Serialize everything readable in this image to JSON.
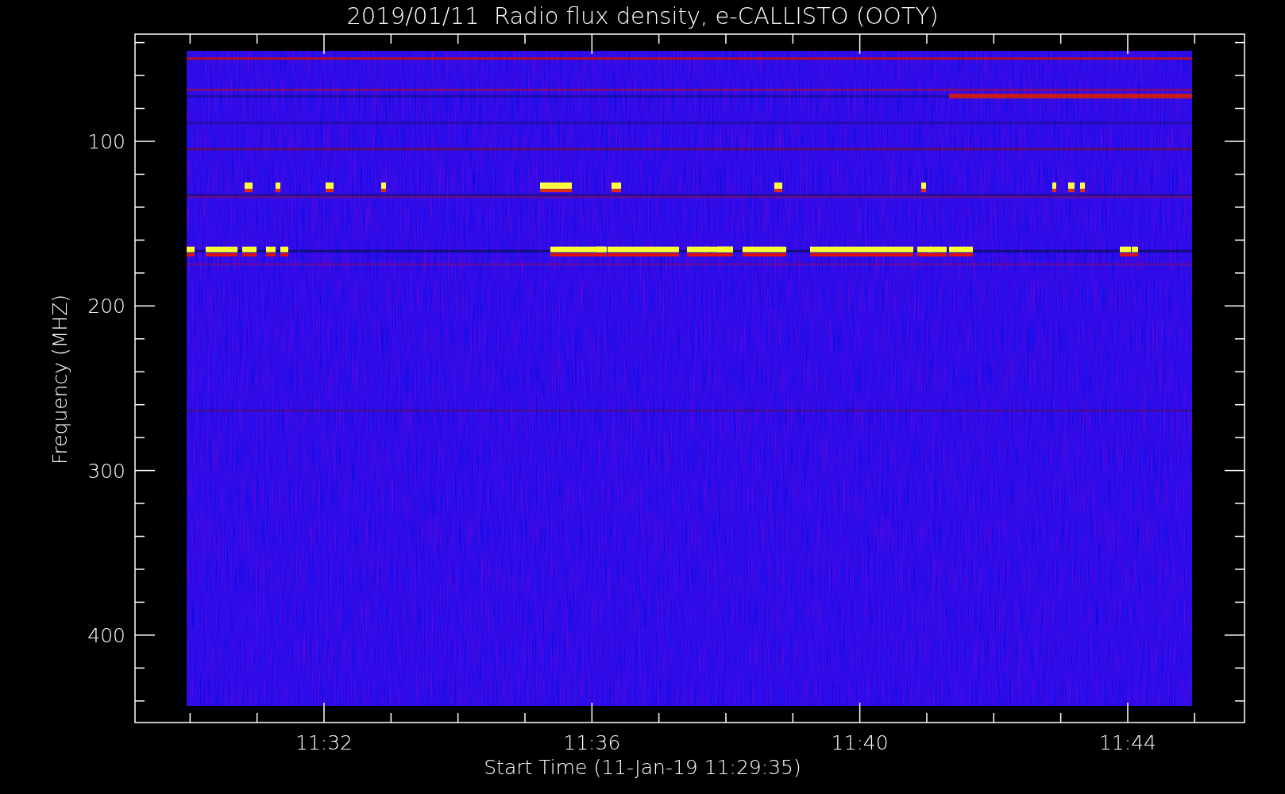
{
  "title": "2019/01/11  Radio flux density, e-CALLISTO (OOTY)",
  "y_axis": {
    "label": "Frequency (MHZ)",
    "tick_labels": [
      "100",
      "200",
      "300",
      "400"
    ]
  },
  "x_axis": {
    "label": "Start Time (11-Jan-19 11:29:35)",
    "tick_labels": [
      "11:32",
      "11:36",
      "11:40",
      "11:44"
    ]
  }
}
